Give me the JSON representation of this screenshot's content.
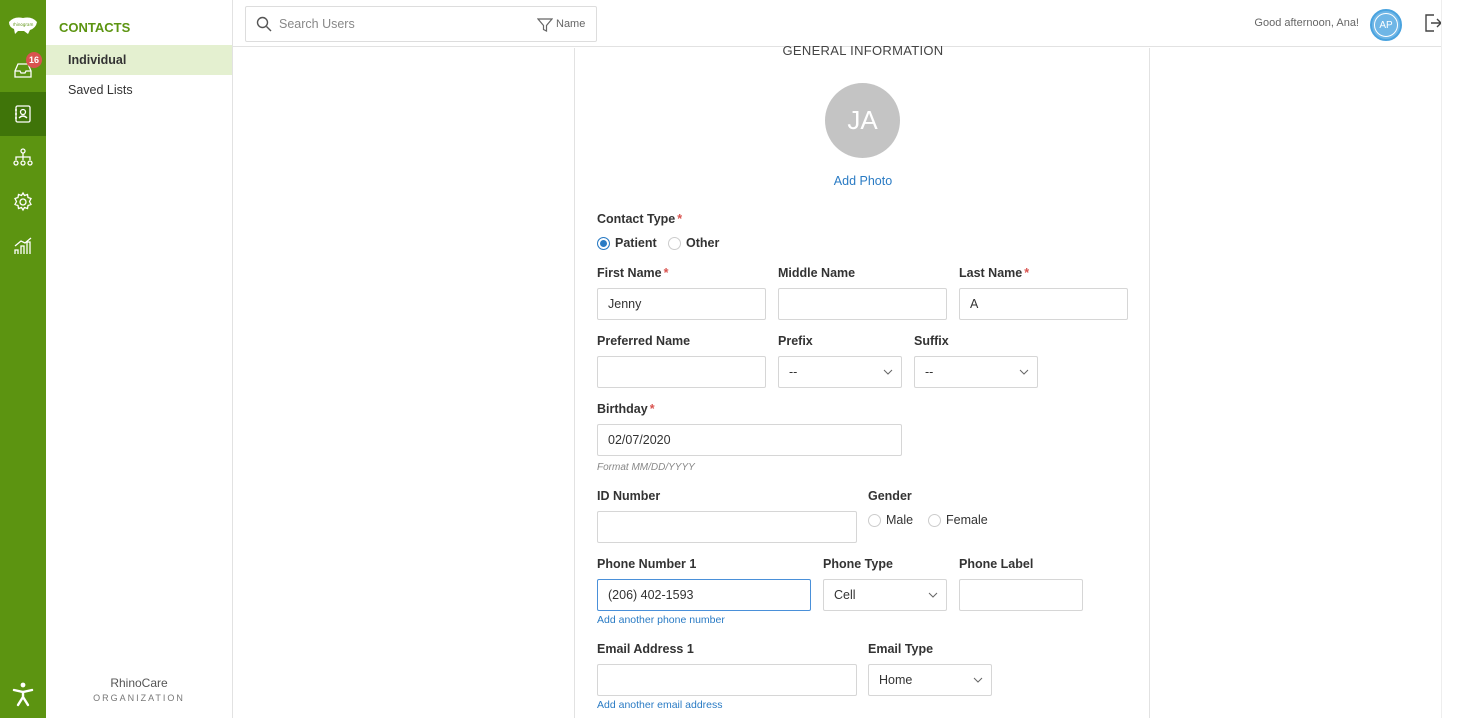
{
  "colors": {
    "brand_green": "#5c9411",
    "brand_green_dark": "#3f7409",
    "link_blue": "#2a7bc4",
    "required_red": "#d9534f"
  },
  "rail": {
    "logo_icon": "rhinogram-logo",
    "inbox_badge": "16",
    "items": [
      "inbox-icon",
      "contacts-icon",
      "org-chart-icon",
      "settings-icon",
      "analytics-icon"
    ],
    "accessibility_icon": "accessibility-icon"
  },
  "subnav": {
    "title": "CONTACTS",
    "items": [
      {
        "label": "Individual"
      },
      {
        "label": "Saved Lists"
      }
    ],
    "org_name": "RhinoCare",
    "org_type": "ORGANIZATION"
  },
  "topbar": {
    "search_placeholder": "Search Users",
    "filter_label": "Name",
    "greeting": "Good afternoon, Ana!",
    "user_initials": "AP"
  },
  "form": {
    "section_title": "GENERAL INFORMATION",
    "avatar_initials": "JA",
    "add_photo": "Add Photo",
    "contact_type": {
      "label": "Contact Type",
      "options": [
        "Patient",
        "Other"
      ],
      "selected": "Patient"
    },
    "first_name": {
      "label": "First Name",
      "value": "Jenny"
    },
    "middle_name": {
      "label": "Middle Name",
      "value": ""
    },
    "last_name": {
      "label": "Last Name",
      "value": "A"
    },
    "preferred_name": {
      "label": "Preferred Name",
      "value": ""
    },
    "prefix": {
      "label": "Prefix",
      "value": "--"
    },
    "suffix": {
      "label": "Suffix",
      "value": "--"
    },
    "birthday": {
      "label": "Birthday",
      "value": "02/07/2020",
      "hint": "Format MM/DD/YYYY"
    },
    "id_number": {
      "label": "ID Number",
      "value": ""
    },
    "gender": {
      "label": "Gender",
      "options": [
        "Male",
        "Female"
      ]
    },
    "phone1": {
      "label": "Phone Number 1",
      "value": "(206) 402-1593",
      "add_link": "Add another phone number"
    },
    "phone_type": {
      "label": "Phone Type",
      "value": "Cell"
    },
    "phone_label": {
      "label": "Phone Label",
      "value": ""
    },
    "email1": {
      "label": "Email Address 1",
      "value": "",
      "add_link": "Add another email address"
    },
    "email_type": {
      "label": "Email Type",
      "value": "Home"
    },
    "required_mark": "*"
  }
}
